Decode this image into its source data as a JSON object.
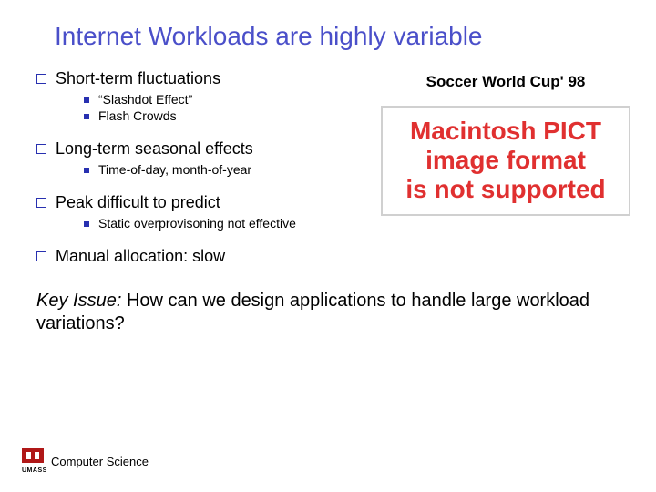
{
  "title": "Internet Workloads are highly variable",
  "rightLabel": "Soccer World Cup' 98",
  "pict": {
    "l1": "Macintosh PICT",
    "l2": "image format",
    "l3": "is not supported"
  },
  "bullets": {
    "b1": {
      "label": "Short-term fluctuations",
      "sub": [
        "“Slashdot Effect”",
        "Flash Crowds"
      ]
    },
    "b2": {
      "label": "Long-term seasonal effects",
      "sub": [
        "Time-of-day, month-of-year"
      ]
    },
    "b3": {
      "label": "Peak difficult to predict",
      "sub": [
        "Static overprovisoning not effective"
      ]
    },
    "b4": {
      "label": "Manual allocation: slow",
      "sub": []
    }
  },
  "keyIssue": {
    "label": "Key Issue:",
    "text": " How can we design applications to handle large workload variations?"
  },
  "footer": {
    "dept": "Computer Science",
    "orgShort": "UMASS"
  }
}
